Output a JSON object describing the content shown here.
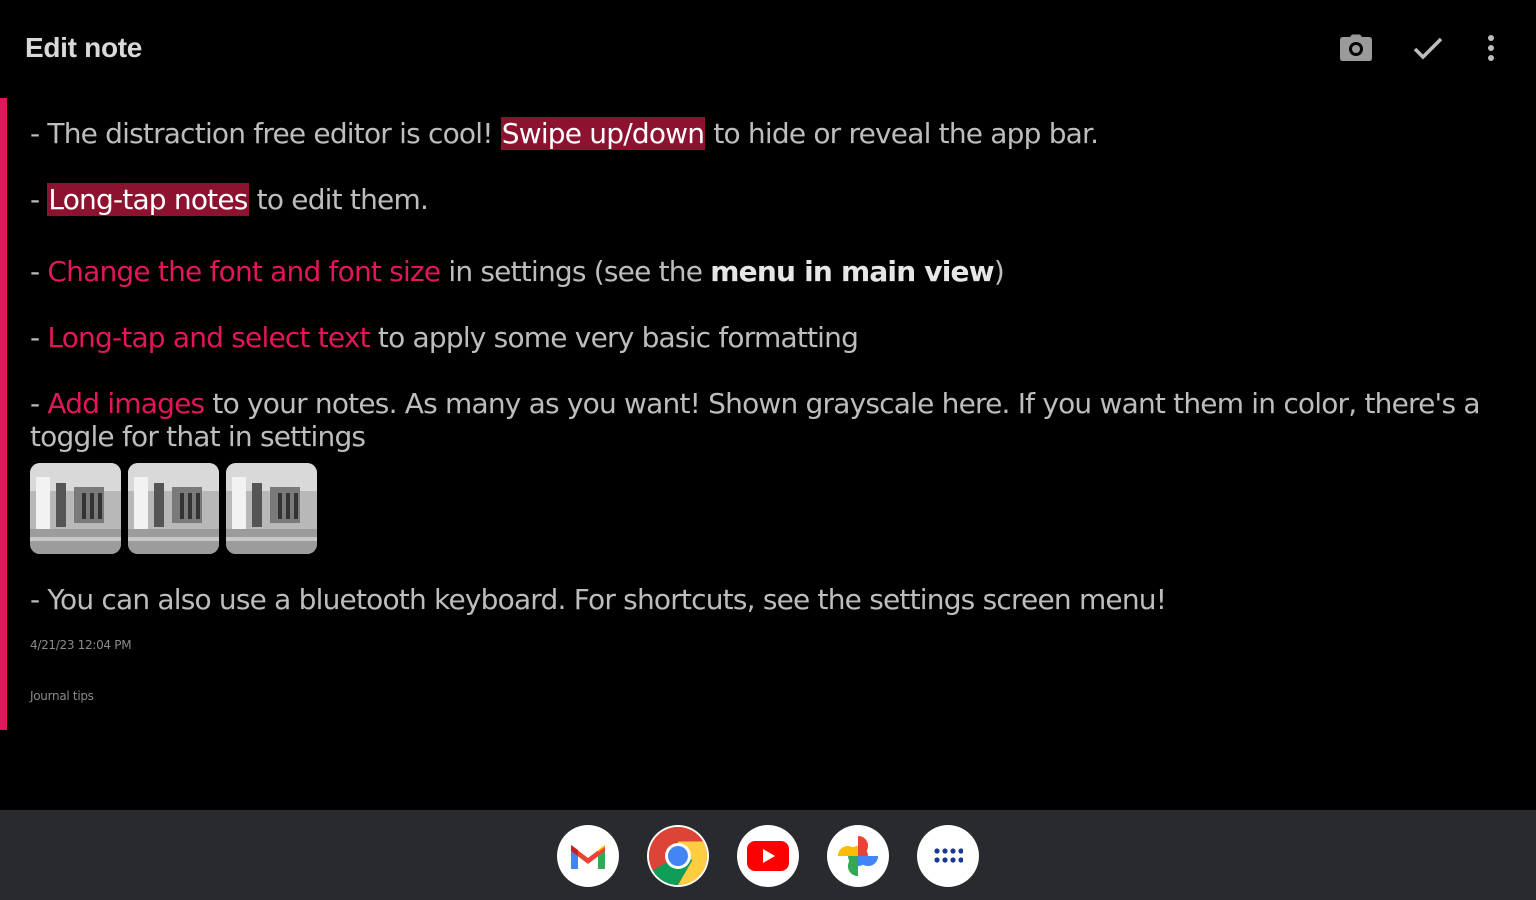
{
  "appbar": {
    "title": "Edit note",
    "actions": [
      {
        "name": "camera",
        "icon": "camera-icon"
      },
      {
        "name": "save",
        "icon": "check-icon"
      },
      {
        "name": "more",
        "icon": "more-vert-icon"
      }
    ]
  },
  "colors": {
    "accent": "#e3165b",
    "highlight_bg": "#8c1230",
    "text": "#bdbdbd",
    "background": "#000000",
    "taskbar": "#282a2e"
  },
  "note": {
    "line1": {
      "prefix": "- The distraction free editor is cool! ",
      "highlight": "Swipe up/down",
      "suffix": " to hide or reveal the app bar."
    },
    "line2": {
      "prefix": "- ",
      "highlight": "Long-tap notes",
      "suffix": " to edit them."
    },
    "line3": {
      "prefix": "- ",
      "accent": "Change the font and font size",
      "middle": " in settings (see the ",
      "bold": "menu in main view",
      "suffix": ")"
    },
    "line4": {
      "prefix": "- ",
      "accent": "Long-tap and select text",
      "suffix": " to apply some very basic formatting"
    },
    "line5": {
      "prefix": "- ",
      "accent": "Add images",
      "suffix": " to your notes. As many as you want! Shown grayscale here. If you want them in color, there's a",
      "continuation": "toggle for that in settings"
    },
    "images": [
      "image-thumbnail",
      "image-thumbnail",
      "image-thumbnail"
    ],
    "line6": "- You can also use a bluetooth keyboard. For shortcuts, see the settings screen menu!",
    "timestamp": "4/21/23 12:04 PM",
    "tag": "Journal tips"
  },
  "taskbar": {
    "apps": [
      {
        "name": "Gmail",
        "icon": "gmail-icon"
      },
      {
        "name": "Chrome",
        "icon": "chrome-icon"
      },
      {
        "name": "YouTube",
        "icon": "youtube-icon"
      },
      {
        "name": "Photos",
        "icon": "photos-icon"
      },
      {
        "name": "App drawer",
        "icon": "app-drawer-icon"
      }
    ]
  }
}
